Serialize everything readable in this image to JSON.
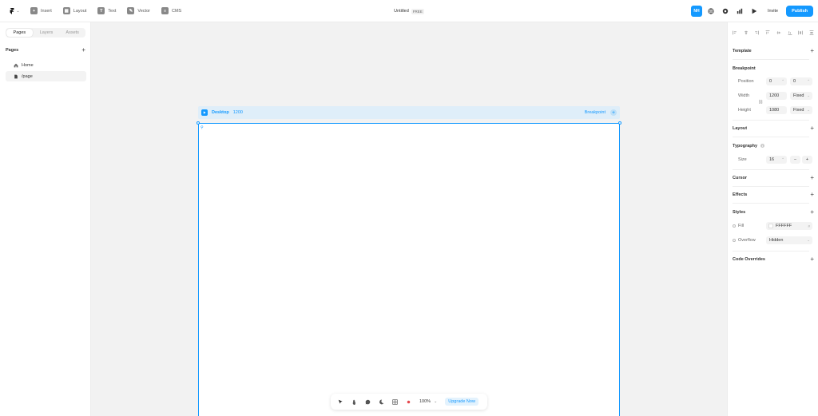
{
  "topbar": {
    "tools": [
      {
        "label": "Insert",
        "icon": "plus-square-icon",
        "glyph": "+"
      },
      {
        "label": "Layout",
        "icon": "layout-icon",
        "glyph": "▦"
      },
      {
        "label": "Text",
        "icon": "text-icon",
        "glyph": "T"
      },
      {
        "label": "Vector",
        "icon": "vector-pen-icon",
        "glyph": "✎"
      },
      {
        "label": "CMS",
        "icon": "database-icon",
        "glyph": "≡"
      }
    ],
    "doc_name": "Untitled",
    "plan_badge": "FREE",
    "avatar_initials": "NH",
    "invite_label": "Invite",
    "publish_label": "Publish"
  },
  "left_panel": {
    "tabs": [
      "Pages",
      "Layers",
      "Assets"
    ],
    "active_tab": "Pages",
    "section_title": "Pages",
    "pages": [
      {
        "label": "Home",
        "icon": "home-icon",
        "selected": false
      },
      {
        "label": "/page",
        "icon": "page-icon",
        "selected": true
      }
    ]
  },
  "canvas": {
    "frame_name": "Desktop",
    "frame_width": "1200",
    "breakpoint_label": "Breakpoint",
    "zoom": "100%",
    "upgrade_label": "Upgrade Now"
  },
  "right_panel": {
    "template_label": "Template",
    "breakpoint_section": "Breakpoint",
    "position_label": "Position",
    "position_x": "0",
    "position_y": "0",
    "width_label": "Width",
    "width_value": "1200",
    "width_mode": "Fixed",
    "height_label": "Height",
    "height_value": "1080",
    "height_mode": "Fixed",
    "layout_label": "Layout",
    "typography_label": "Typography",
    "size_label": "Size",
    "size_value": "16",
    "cursor_label": "Cursor",
    "effects_label": "Effects",
    "styles_label": "Styles",
    "fill_label": "Fill",
    "fill_value": "FFFFFF",
    "overflow_label": "Overflow",
    "overflow_value": "Hidden",
    "code_overrides_label": "Code Overrides"
  },
  "colors": {
    "accent": "#1499ff",
    "canvas_bg": "#f2f2f2"
  }
}
